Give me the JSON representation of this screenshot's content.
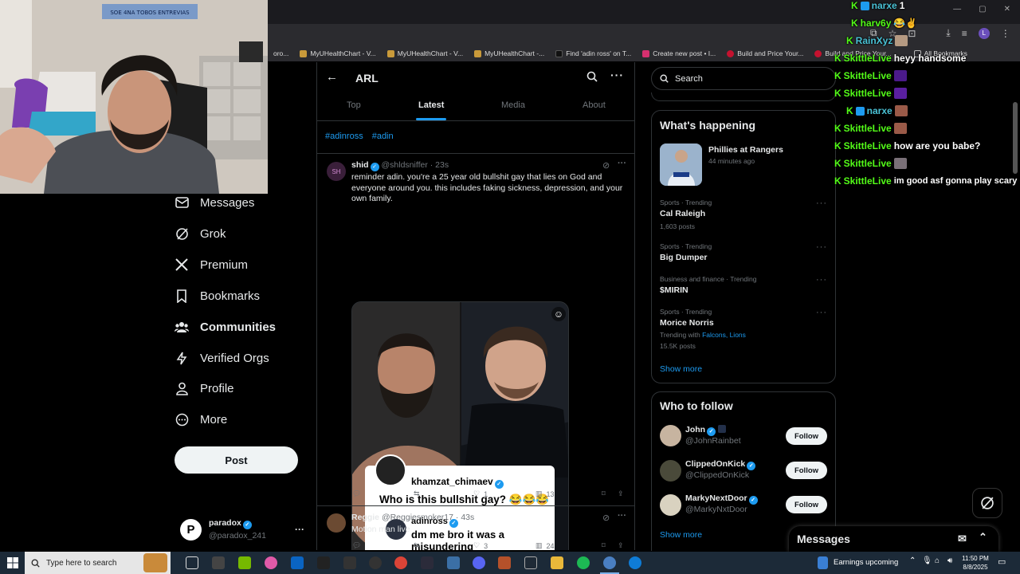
{
  "browser": {
    "bookmarks": [
      "MyUHealthChart - V...",
      "MyUHealthChart - V...",
      "MyUHealthChart -...",
      "Find 'adin ross' on T...",
      "Create new post • I...",
      "Build and Price Your...",
      "Build and Price Your..."
    ],
    "all_bookmarks": "All Bookmarks",
    "bookmark_partial": "oro...",
    "profile_letter": "L"
  },
  "webcam": {
    "banner_text": "SOE 4NA TOBOS ENTREVIAS"
  },
  "nav": {
    "messages": "Messages",
    "grok": "Grok",
    "premium": "Premium",
    "bookmarks": "Bookmarks",
    "communities": "Communities",
    "verified_orgs": "Verified Orgs",
    "profile": "Profile",
    "more": "More",
    "post": "Post"
  },
  "account": {
    "initial": "P",
    "name": "paradox",
    "handle": "@paradox_241",
    "more": "···"
  },
  "header": {
    "title": "ARL",
    "back": "←",
    "tabs": [
      "Top",
      "Latest",
      "Media",
      "About"
    ]
  },
  "hashtags": [
    "#adinross",
    "#adin"
  ],
  "tweet1": {
    "avatar_text": "SH",
    "name": "shid",
    "handle": "@shldsniffer",
    "time": "· 23s",
    "text": "reminder adin. you're a 25 year old bullshit gay that lies on God and everyone around you. this includes faking sickness, depression, and your own family.",
    "card": {
      "author": "khamzat_chimaev",
      "question": "Who is this bullshit gay? 😂😂😂",
      "reply_author": "adinross",
      "reply_text": "dm me bro it was a misundering"
    },
    "likes": "1",
    "views": "13"
  },
  "tweet2": {
    "name": "Reggie",
    "handle": "@Reggiesmoker17",
    "time": "· 43s",
    "text": "Motion man live",
    "likes": "3",
    "views": "24"
  },
  "search": {
    "placeholder": "Search"
  },
  "happening": {
    "title": "What's happening",
    "featured": {
      "title": "Phillies at Rangers",
      "time": "44 minutes ago"
    },
    "trends": [
      {
        "context": "Sports · Trending",
        "name": "Cal Raleigh",
        "count": "1,603 posts"
      },
      {
        "context": "Sports · Trending",
        "name": "Big Dumper",
        "count": ""
      },
      {
        "context": "Business and finance · Trending",
        "name": "$MIRIN",
        "count": ""
      },
      {
        "context": "Sports · Trending",
        "name": "Morice Norris",
        "with_label": "Trending with",
        "with_links": "Falcons, Lions",
        "count": "15.5K posts"
      }
    ],
    "show_more": "Show more"
  },
  "who_to_follow": {
    "title": "Who to follow",
    "accounts": [
      {
        "name": "John",
        "handle": "@JohnRainbet",
        "button": "Follow"
      },
      {
        "name": "ClippedOnKick",
        "handle": "@ClippedOnKick",
        "button": "Follow"
      },
      {
        "name": "MarkyNextDoor",
        "handle": "@MarkyNxtDoor",
        "button": "Follow"
      }
    ],
    "show_more": "Show more"
  },
  "messages_drawer": {
    "title": "Messages"
  },
  "chat": [
    {
      "user": "narxe",
      "text": "1"
    },
    {
      "user": "harv6y",
      "text": "😂✌"
    },
    {
      "user": "RainXyz",
      "text": ""
    },
    {
      "user": "SkittleLive",
      "text": "heyy handsome"
    },
    {
      "user": "SkittleLive",
      "text": ""
    },
    {
      "user": "SkittleLive",
      "text": ""
    },
    {
      "user": "narxe",
      "text": ""
    },
    {
      "user": "SkittleLive",
      "text": ""
    },
    {
      "user": "SkittleLive",
      "text": "how are you babe?"
    },
    {
      "user": "SkittleLive",
      "text": ""
    },
    {
      "user": "SkittleLive",
      "text": "im good asf gonna play scary"
    }
  ],
  "taskbar": {
    "search_placeholder": "Type here to search",
    "weather": "Earnings upcoming",
    "time": "11:50 PM",
    "date": "8/8/2025"
  },
  "colors": {
    "accent": "#1d9bf0",
    "kick_green": "#53fc18",
    "taskbar": "#1c2a38"
  }
}
